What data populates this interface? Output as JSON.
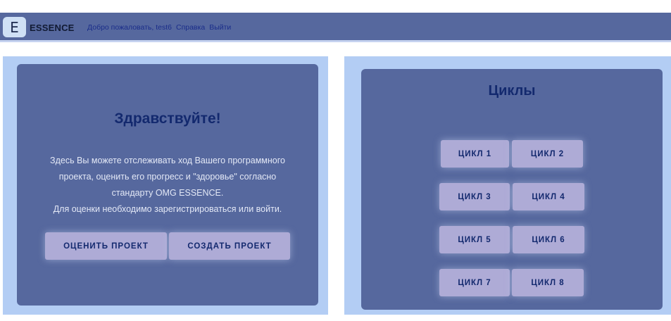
{
  "header": {
    "logo_letter": "E",
    "brand": "ESSENCE",
    "links": [
      "Добро пожаловать, test6",
      "Справка",
      "Выйти"
    ]
  },
  "welcome": {
    "title": "Здравствуйте!",
    "lines": [
      "Здесь Вы можете отслеживать ход Вашего программного",
      "проекта, оценить его прогресс и \"здоровье\" согласно",
      "стандарту OMG ESSENCE.",
      "Для оценки необходимо зарегистрироваться или войти."
    ],
    "buttons": [
      "ОЦЕНИТЬ ПРОЕКТ",
      "СОЗДАТЬ ПРОЕКТ"
    ]
  },
  "cycles": {
    "title": "Циклы",
    "buttons": [
      "ЦИКЛ 1",
      "ЦИКЛ 2",
      "ЦИКЛ 3",
      "ЦИКЛ 4",
      "ЦИКЛ 5",
      "ЦИКЛ 6",
      "ЦИКЛ 7",
      "ЦИКЛ 8"
    ]
  }
}
